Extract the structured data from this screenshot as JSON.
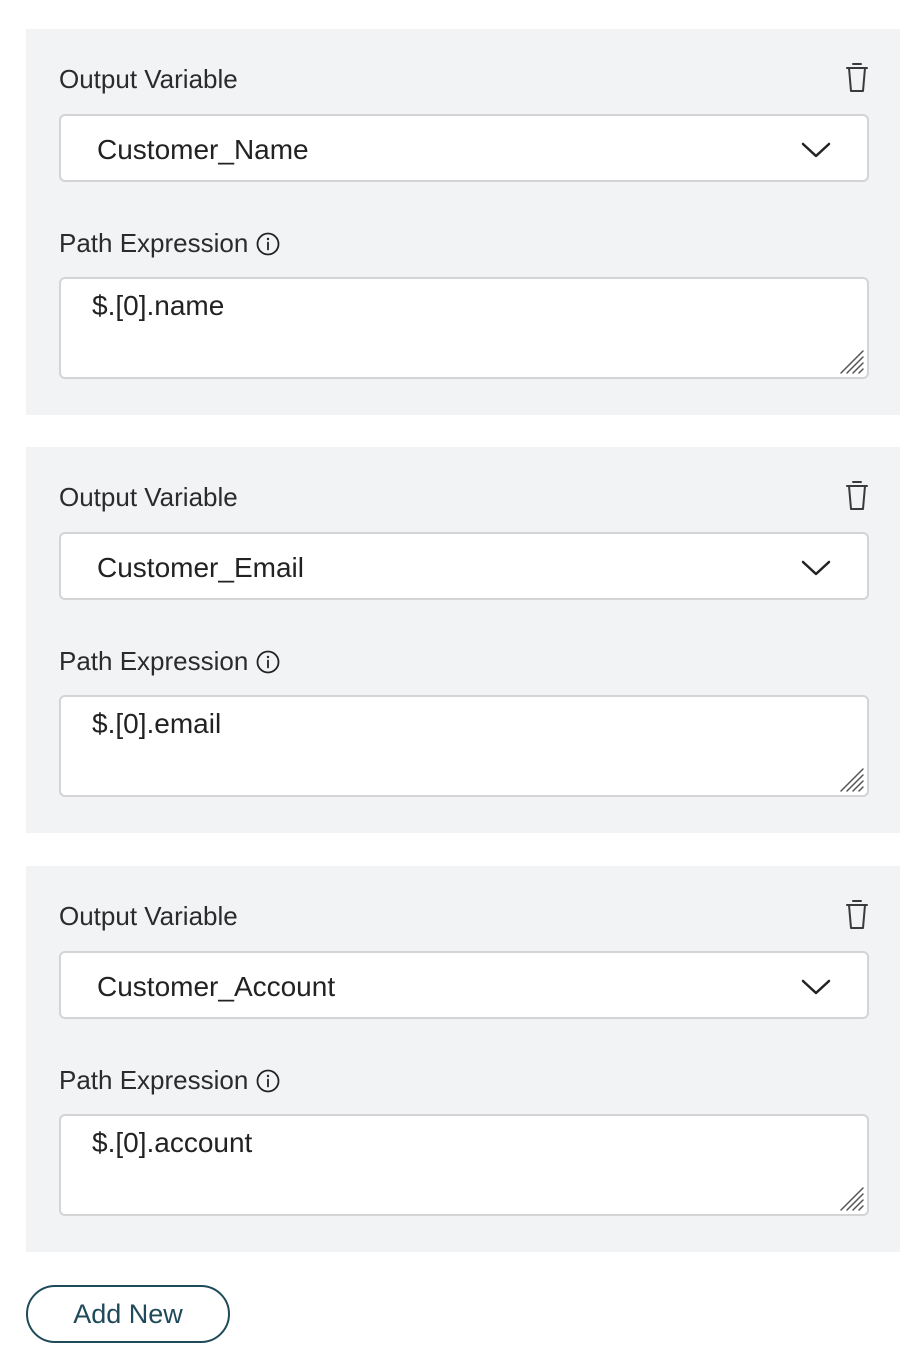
{
  "mappings": [
    {
      "output_label": "Output Variable",
      "output_value": "Customer_Name",
      "path_label": "Path Expression",
      "path_value": "$.[0].name"
    },
    {
      "output_label": "Output Variable",
      "output_value": "Customer_Email",
      "path_label": "Path Expression",
      "path_value": "$.[0].email"
    },
    {
      "output_label": "Output Variable",
      "output_value": "Customer_Account",
      "path_label": "Path Expression",
      "path_value": "$.[0].account"
    }
  ],
  "add_button_label": "Add New",
  "icons": {
    "delete": "trash-icon",
    "dropdown": "chevron-down-icon",
    "info": "info-icon",
    "resize": "resize-handle-icon"
  },
  "colors": {
    "panel_background": "#f2f3f5",
    "field_border": "#d4d4d6",
    "button_accent": "#1f4a5a",
    "text": "#222222"
  }
}
